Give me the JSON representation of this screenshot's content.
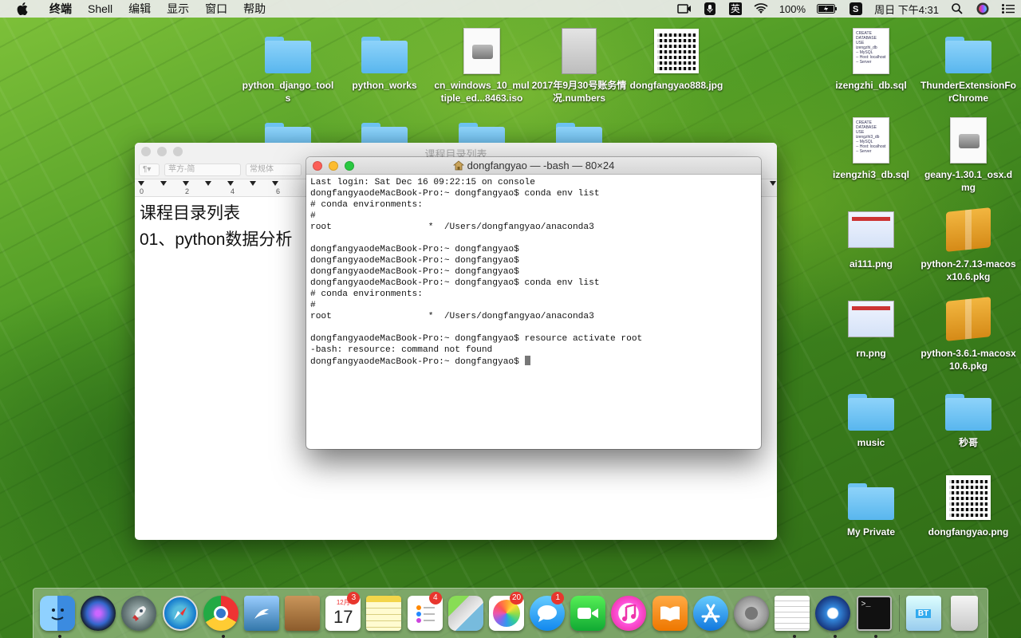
{
  "menubar": {
    "app_name": "终端",
    "menus": [
      "Shell",
      "编辑",
      "显示",
      "窗口",
      "帮助"
    ],
    "input_method": "英",
    "battery": "100%",
    "clock": "周日 下午4:31"
  },
  "desktop": {
    "icons": [
      {
        "label": "python_django_tools",
        "kind": "folder"
      },
      {
        "label": "python_works",
        "kind": "folder"
      },
      {
        "label": "cn_windows_10_multiple_ed...8463.iso",
        "kind": "disk"
      },
      {
        "label": "2017年9月30号账务情况.numbers",
        "kind": "numbers"
      },
      {
        "label": "dongfangyao888.jpg",
        "kind": "qr"
      },
      {
        "label": "izengzhi_db.sql",
        "kind": "sql"
      },
      {
        "label": "ThunderExtensionForChrome",
        "kind": "folder"
      },
      {
        "label": "izengzhi3_db.sql",
        "kind": "sql"
      },
      {
        "label": "geany-1.30.1_osx.dmg",
        "kind": "disk"
      },
      {
        "label": "ai111.png",
        "kind": "png"
      },
      {
        "label": "python-2.7.13-macosx10.6.pkg",
        "kind": "pkg"
      },
      {
        "label": "rn.png",
        "kind": "png"
      },
      {
        "label": "python-3.6.1-macosx10.6.pkg",
        "kind": "pkg"
      },
      {
        "label": "music",
        "kind": "folder"
      },
      {
        "label": "秒哥",
        "kind": "folder"
      },
      {
        "label": "My Private",
        "kind": "folder"
      },
      {
        "label": "dongfangyao.png",
        "kind": "qr"
      }
    ]
  },
  "document_window": {
    "title": "课程目录列表",
    "style_select": "常规体",
    "font_select": "苹方-简",
    "ruler_numbers": [
      "0",
      "2",
      "4",
      "6"
    ],
    "lines": [
      "课程目录列表",
      "01、python数据分析"
    ]
  },
  "terminal": {
    "title": "dongfangyao — -bash — 80×24",
    "lines": [
      "Last login: Sat Dec 16 09:22:15 on console",
      "dongfangyaodeMacBook-Pro:~ dongfangyao$ conda env list",
      "# conda environments:",
      "#",
      "root                  *  /Users/dongfangyao/anaconda3",
      "",
      "dongfangyaodeMacBook-Pro:~ dongfangyao$",
      "dongfangyaodeMacBook-Pro:~ dongfangyao$",
      "dongfangyaodeMacBook-Pro:~ dongfangyao$",
      "dongfangyaodeMacBook-Pro:~ dongfangyao$ conda env list",
      "# conda environments:",
      "#",
      "root                  *  /Users/dongfangyao/anaconda3",
      "",
      "dongfangyaodeMacBook-Pro:~ dongfangyao$ resource activate root",
      "-bash: resource: command not found"
    ],
    "prompt": "dongfangyaodeMacBook-Pro:~ dongfangyao$ "
  },
  "dock": {
    "calendar_month": "12月",
    "calendar_day": "17",
    "calendar_badge": "3",
    "reminders_badge": "4",
    "photos_badge": "20",
    "messages_badge": "1",
    "apps": [
      "Finder",
      "Siri",
      "Launchpad",
      "Safari",
      "Chrome",
      "Mail",
      "Contacts",
      "Calendar",
      "Notes",
      "Reminders",
      "Maps",
      "Photos",
      "Messages",
      "FaceTime",
      "iTunes",
      "iBooks",
      "App Store",
      "System Preferences",
      "TextEdit",
      "Screen Recorder",
      "Terminal",
      "BT",
      "Trash"
    ],
    "bt_label": "BT"
  }
}
